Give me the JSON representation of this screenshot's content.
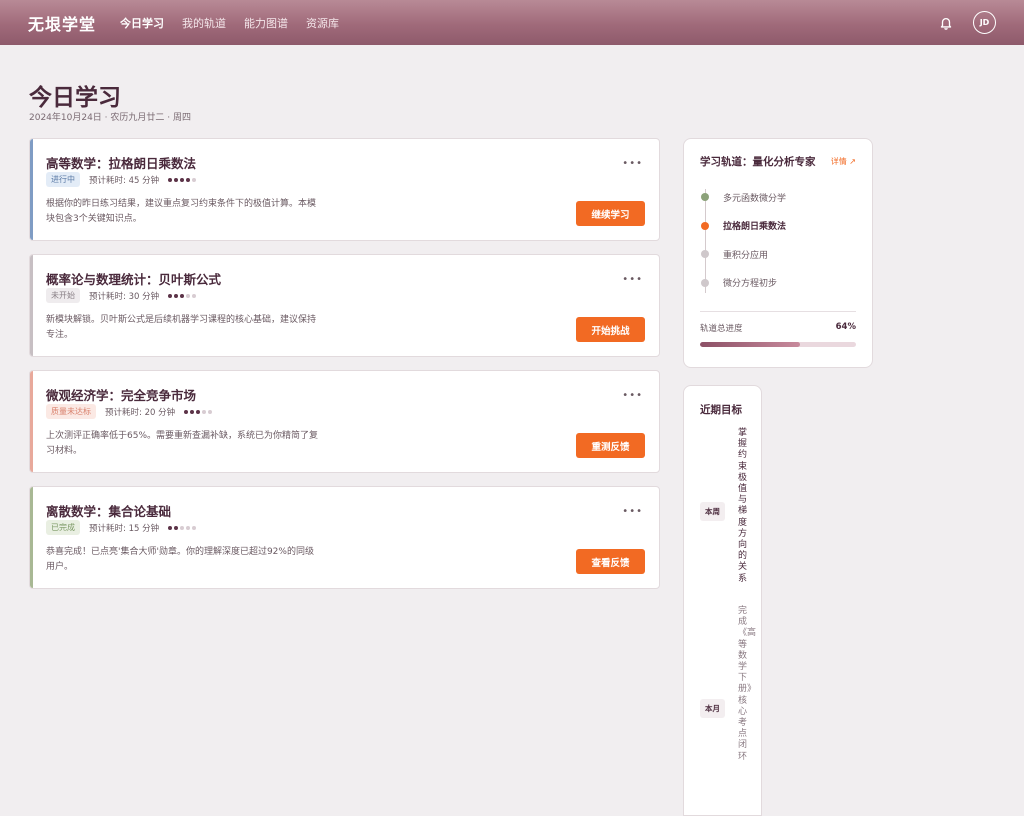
{
  "app": {
    "logo": "无垠学堂"
  },
  "nav": [
    {
      "label": "今日学习",
      "active": true
    },
    {
      "label": "我的轨道",
      "active": false
    },
    {
      "label": "能力图谱",
      "active": false
    },
    {
      "label": "资源库",
      "active": false
    }
  ],
  "user": {
    "initials": "JD"
  },
  "page": {
    "title": "今日学习",
    "date": "2024年10月24日 · 农历九月廿二 · 周四"
  },
  "meta_prefix": "预计耗时: ",
  "tasks": [
    {
      "title": "高等数学：拉格朗日乘数法",
      "status": "进行中",
      "time": "预计耗时: 45 分钟",
      "difficulty": 4,
      "difficulty_max": 5,
      "desc": "根据你的昨日练习结果，建议重点复习约束条件下的极值计算。本模块包含3个关键知识点。",
      "button": "继续学习",
      "accent": "#7f9cc4",
      "badge_bg": "#e3ecf7",
      "badge_fg": "#5b7aa6"
    },
    {
      "title": "概率论与数理统计：贝叶斯公式",
      "status": "未开始",
      "time": "预计耗时: 30 分钟",
      "difficulty": 3,
      "difficulty_max": 5,
      "desc": "新模块解锁。贝叶斯公式是后续机器学习课程的核心基础，建议保持专注。",
      "button": "开始挑战",
      "accent": "#c7bfc3",
      "badge_bg": "#efecee",
      "badge_fg": "#8a8086"
    },
    {
      "title": "微观经济学：完全竞争市场",
      "status": "质量未达标",
      "time": "预计耗时: 20 分钟",
      "difficulty": 3,
      "difficulty_max": 5,
      "desc": "上次测评正确率低于65%。需要重新查漏补缺，系统已为你精简了复习材料。",
      "button": "重测反馈",
      "accent": "#e8a99b",
      "badge_bg": "#fbe9e4",
      "badge_fg": "#d9826e"
    },
    {
      "title": "离散数学：集合论基础",
      "status": "已完成",
      "time": "预计耗时: 15 分钟",
      "difficulty": 2,
      "difficulty_max": 5,
      "desc": "恭喜完成！已点亮'集合大师'勋章。你的理解深度已超过92%的同级用户。",
      "button": "查看反馈",
      "accent": "#a8b894",
      "badge_bg": "#e9efe2",
      "badge_fg": "#7d9a66"
    }
  ],
  "track": {
    "title": "学习轨道：量化分析专家",
    "detail": "详情 ↗",
    "steps": [
      {
        "label": "多元函数微分学",
        "state": "done"
      },
      {
        "label": "拉格朗日乘数法",
        "state": "current"
      },
      {
        "label": "重积分应用",
        "state": "todo"
      },
      {
        "label": "微分方程初步",
        "state": "todo"
      }
    ],
    "progress_label": "轨道总进度",
    "progress_text": "64%",
    "progress_value": 0.64
  },
  "goals": {
    "title": "近期目标",
    "items": [
      {
        "tag": "本周",
        "text": "掌握约束极值与梯度方向的关系"
      },
      {
        "tag": "本月",
        "text": "完成《高等数学下册》核心考点闭环"
      }
    ]
  },
  "colors": {
    "accent_orange": "#f26a23",
    "brand_plum": "#4a2a3c",
    "header": "#a06a7a"
  }
}
